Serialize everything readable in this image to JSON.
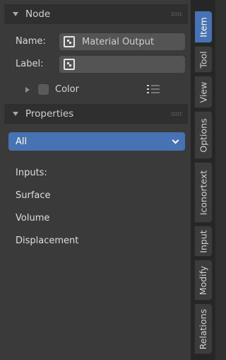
{
  "node_panel": {
    "title": "Node",
    "name_label": "Name:",
    "name_value": "Material Output",
    "label_label": "Label:",
    "label_value": "",
    "color_label": "Color"
  },
  "properties_panel": {
    "title": "Properties",
    "dropdown_value": "All",
    "items": [
      "Inputs:",
      "Surface",
      "Volume",
      "Displacement"
    ]
  },
  "tabs": [
    "Item",
    "Tool",
    "View",
    "Options",
    "Iconortext",
    "Input",
    "Modify",
    "Relations"
  ],
  "colors": {
    "accent": "#4772b3",
    "panel_bg": "#3a3a3a",
    "header_bg": "#2f2f2f"
  },
  "icons": {
    "node": "node-icon",
    "list": "list-icon",
    "collapse": "disclosure-triangle-icon"
  }
}
